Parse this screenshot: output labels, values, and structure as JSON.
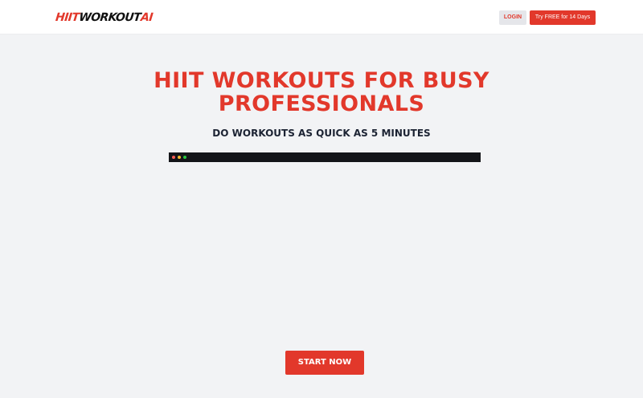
{
  "header": {
    "logo": {
      "part1": "HIIT",
      "part2": "WORKOUT",
      "part3": "AI"
    },
    "login_label": "LOGIN",
    "trial_label": "Try FREE for 14 Days"
  },
  "hero": {
    "title": "HIIT WORKOUTS FOR BUSY PROFESSIONALS",
    "subtitle": "DO WORKOUTS AS QUICK AS 5 MINUTES",
    "cta_label": "START NOW"
  },
  "video_window": {
    "controls": [
      "window-close-dot",
      "window-minimize-dot",
      "window-maximize-dot"
    ]
  },
  "colors": {
    "brand_red": "#e2382b",
    "page_bg": "#f2f3f5",
    "dark_text": "#1c2333",
    "video_bar": "#141519"
  }
}
